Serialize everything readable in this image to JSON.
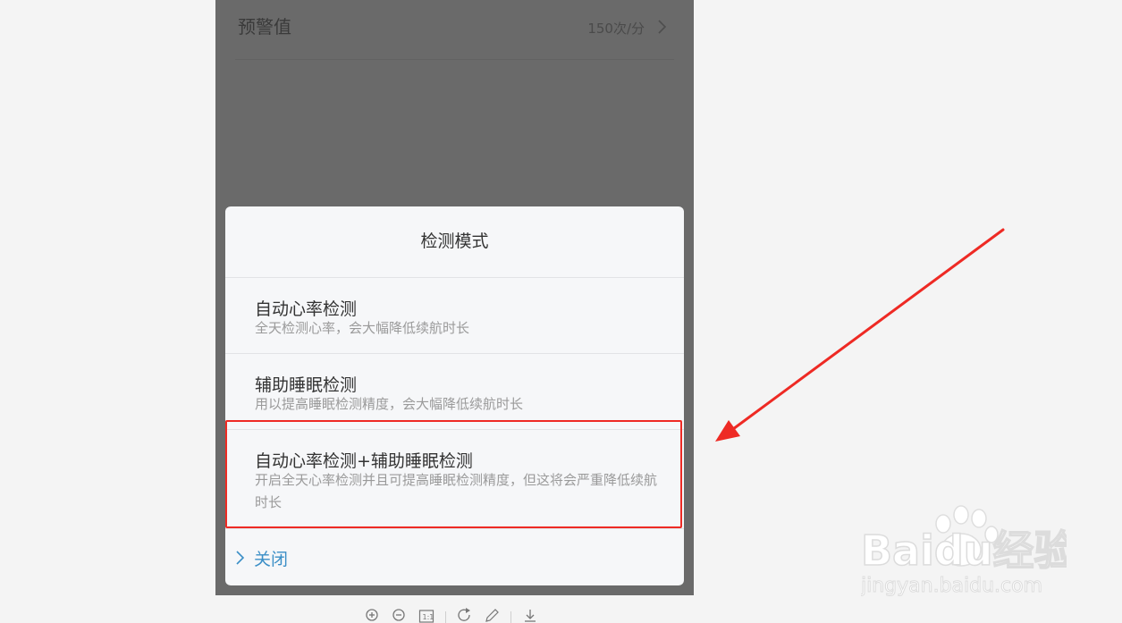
{
  "setting": {
    "label": "预警值",
    "value": "150次/分",
    "icon": "chevron-right-icon"
  },
  "dialog": {
    "title": "检测模式",
    "options": [
      {
        "title": "自动心率检测",
        "desc": "全天检测心率，会大幅降低续航时长"
      },
      {
        "title": "辅助睡眠检测",
        "desc": "用以提高睡眠检测精度，会大幅降低续航时长"
      },
      {
        "title": "自动心率检测+辅助睡眠检测",
        "desc": "开启全天心率检测并且可提高睡眠检测精度，但这将会严重降低续航时长"
      }
    ],
    "close_label": "关闭"
  },
  "annotation": {
    "highlight_color": "#ee2a24",
    "arrow_color": "#ee2a24"
  },
  "watermark": {
    "brand": "Baidu经验",
    "url": "jingyan.baidu.com"
  },
  "toolbar": {
    "icons": [
      "zoom-in-icon",
      "zoom-out-icon",
      "actual-size-icon",
      "rotate-icon",
      "edit-icon",
      "download-icon"
    ]
  }
}
